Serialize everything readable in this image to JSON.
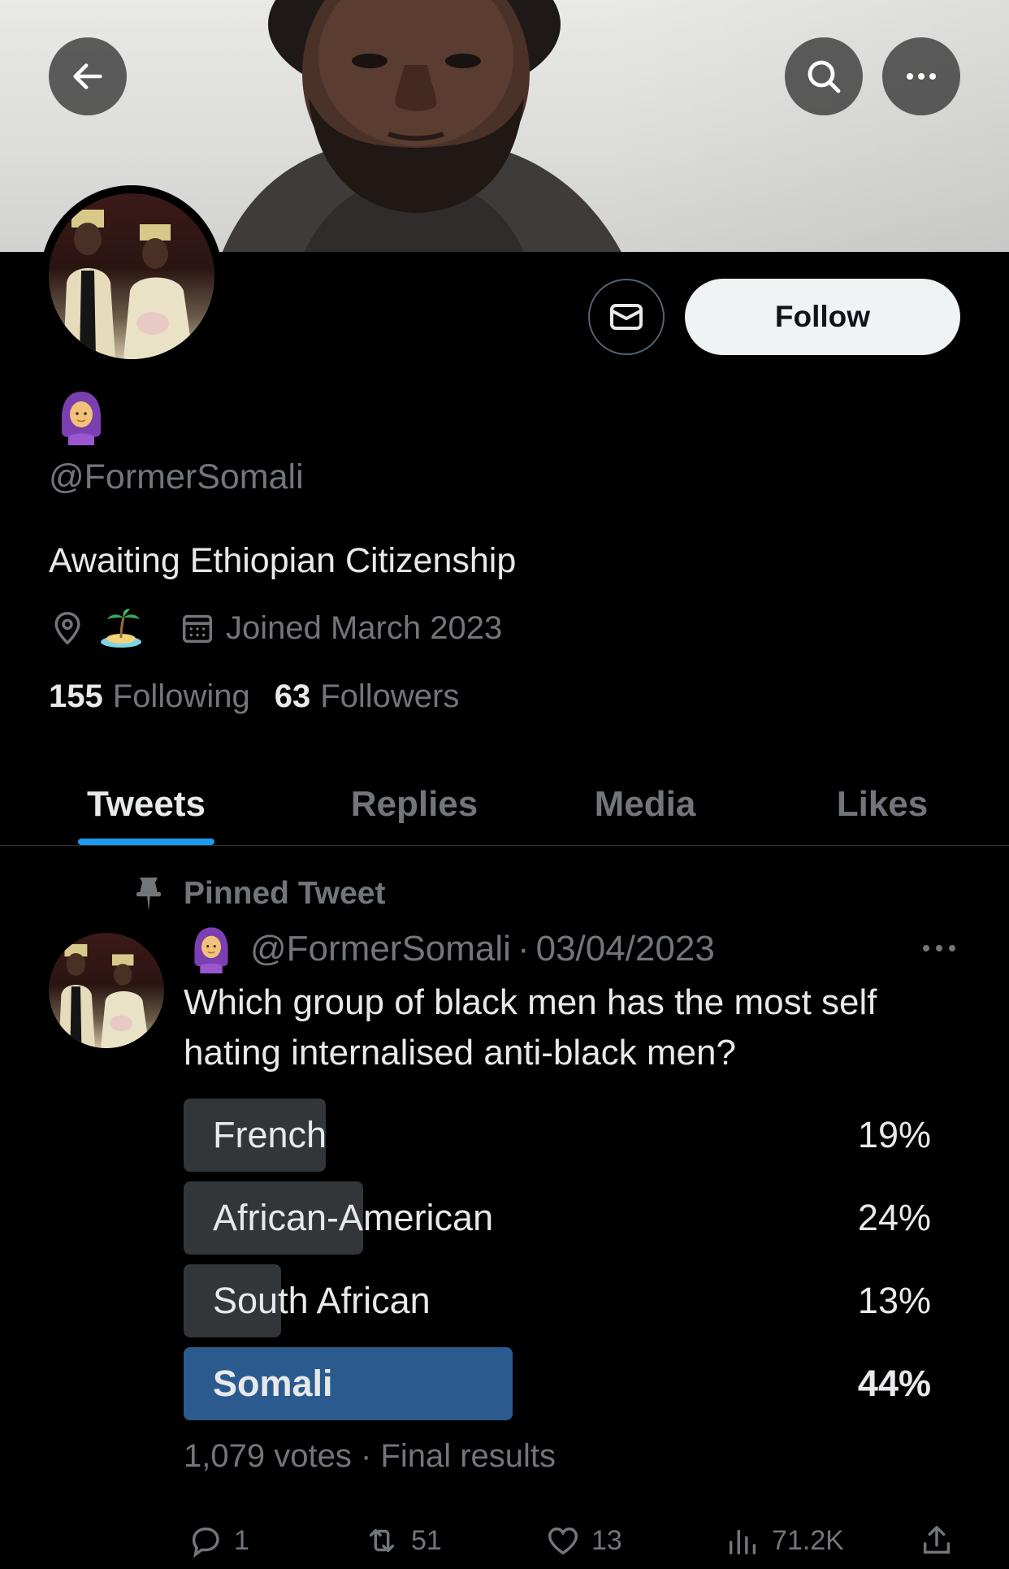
{
  "header": {
    "back_icon": "arrow-left-icon",
    "search_icon": "search-icon",
    "more_icon": "more-horizontal-icon"
  },
  "profile": {
    "display_emoji": "woman-with-headscarf-emoji",
    "handle": "@FormerSomali",
    "bio": "Awaiting Ethiopian Citizenship",
    "location_emoji": "desert-island-emoji",
    "joined": "Joined March 2023",
    "following_count": "155",
    "following_label": "Following",
    "followers_count": "63",
    "followers_label": "Followers",
    "follow_button": "Follow",
    "message_icon": "envelope-icon"
  },
  "tabs": [
    {
      "label": "Tweets",
      "active": true
    },
    {
      "label": "Replies",
      "active": false
    },
    {
      "label": "Media",
      "active": false
    },
    {
      "label": "Likes",
      "active": false
    }
  ],
  "tweet": {
    "pinned_label": "Pinned Tweet",
    "handle": "@FormerSomali",
    "separator": "·",
    "date": "03/04/2023",
    "text": "Which group of black men has the most self hating internalised anti-black men?",
    "poll": {
      "options": [
        {
          "label": "French",
          "percent_text": "19%",
          "percent": 19
        },
        {
          "label": "African-American",
          "percent_text": "24%",
          "percent": 24
        },
        {
          "label": "South African",
          "percent_text": "13%",
          "percent": 13
        },
        {
          "label": "Somali",
          "percent_text": "44%",
          "percent": 44,
          "winner": true
        }
      ],
      "votes": "1,079 votes",
      "separator": "·",
      "status": "Final results"
    },
    "actions": {
      "replies": "1",
      "retweets": "51",
      "likes": "13",
      "views": "71.2K"
    }
  },
  "colors": {
    "accent": "#1d9bf0",
    "poll_winner": "#2b5a8e",
    "poll_bar": "#333639",
    "muted": "#71767b",
    "text": "#e7e9ea"
  }
}
